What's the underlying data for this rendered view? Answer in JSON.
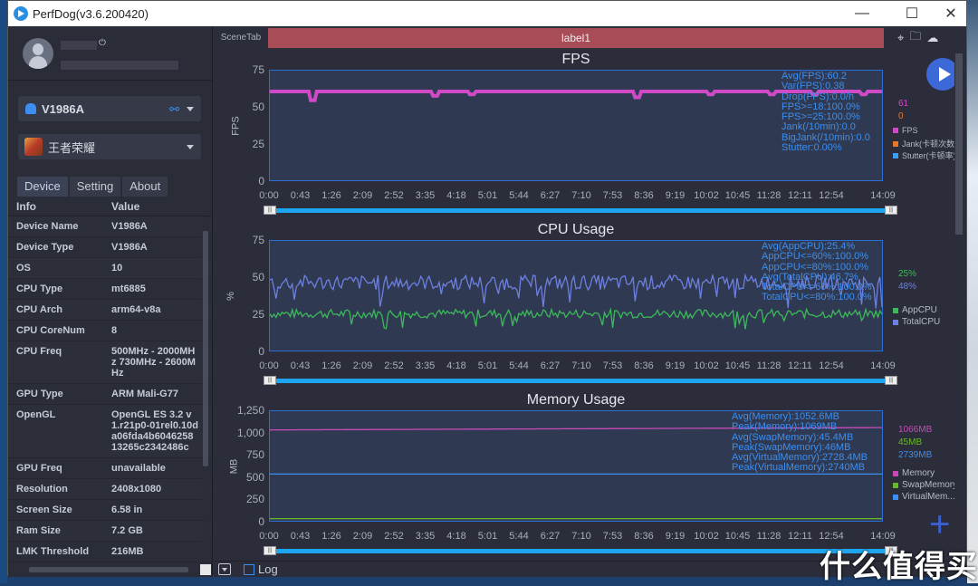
{
  "window": {
    "title": "PerfDog(v3.6.200420)",
    "controls": {
      "minimize": "—",
      "maximize": "☐",
      "close": "✕"
    }
  },
  "sidebar": {
    "device": {
      "name": "V1986A",
      "icon": "android-icon"
    },
    "app": {
      "name": "王者荣耀",
      "icon": "game-icon"
    },
    "tabs": [
      {
        "label": "Device"
      },
      {
        "label": "Setting"
      },
      {
        "label": "About"
      }
    ],
    "table": {
      "headers": [
        "Info",
        "Value"
      ],
      "rows": [
        {
          "key": "Device Name",
          "value": "V1986A"
        },
        {
          "key": "Device Type",
          "value": "V1986A"
        },
        {
          "key": "OS",
          "value": "10"
        },
        {
          "key": "CPU Type",
          "value": "mt6885"
        },
        {
          "key": "CPU Arch",
          "value": "arm64-v8a"
        },
        {
          "key": "CPU CoreNum",
          "value": "8"
        },
        {
          "key": "CPU Freq",
          "value": "500MHz - 2000MHz 730MHz - 2600MHz"
        },
        {
          "key": "GPU Type",
          "value": "ARM Mali-G77"
        },
        {
          "key": "OpenGL",
          "value": "OpenGL ES 3.2 v1.r21p0-01rel0.10da06fda4b604625813265c2342486c"
        },
        {
          "key": "GPU Freq",
          "value": "unavailable"
        },
        {
          "key": "Resolution",
          "value": "2408x1080"
        },
        {
          "key": "Screen Size",
          "value": "6.58 in"
        },
        {
          "key": "Ram Size",
          "value": "7.2 GB"
        },
        {
          "key": "LMK Threshold",
          "value": "216MB"
        }
      ]
    }
  },
  "main": {
    "scene_tab": "SceneTab",
    "label": "label1",
    "top_icons": [
      "location-icon",
      "folder-icon",
      "cloud-icon"
    ],
    "log_label": "Log"
  },
  "watermark": "什么值得买",
  "chart_data": [
    {
      "type": "line",
      "title": "FPS",
      "ylabel": "FPS",
      "ylim": [
        0,
        75
      ],
      "yticks": [
        "0",
        "25",
        "50",
        "75"
      ],
      "xticks": [
        "0:00",
        "0:43",
        "1:26",
        "2:09",
        "2:52",
        "3:35",
        "4:18",
        "5:01",
        "5:44",
        "6:27",
        "7:10",
        "7:53",
        "8:36",
        "9:19",
        "10:02",
        "10:45",
        "11:28",
        "12:11",
        "12:54",
        "14:09"
      ],
      "series": [
        {
          "name": "FPS",
          "color": "#d04ac8",
          "baseline": 61,
          "dips": [
            [
              0.07,
              55
            ],
            [
              0.27,
              58
            ],
            [
              0.33,
              59
            ],
            [
              0.6,
              57
            ],
            [
              0.72,
              59
            ],
            [
              0.82,
              59
            ],
            [
              0.89,
              59
            ],
            [
              0.97,
              59
            ]
          ]
        }
      ],
      "stats": [
        "Avg(FPS):60.2",
        "Var(FPS):0.38",
        "Drop(FPS):0.0/h",
        "FPS>=18:100.0%",
        "FPS>=25:100.0%",
        "Jank(/10min):0.0",
        "BigJank(/10min):0.0",
        "Stutter:0.00%"
      ],
      "current_values": [
        {
          "value": "61",
          "color": "#d04ac8"
        },
        {
          "value": "0",
          "color": "#e8782c"
        }
      ],
      "legend": [
        {
          "label": "FPS",
          "color": "#d04ac8"
        },
        {
          "label": "Jank(卡顿次数)",
          "color": "#e8782c"
        },
        {
          "label": "Stutter(卡顿率)",
          "color": "#3c9ef0"
        }
      ]
    },
    {
      "type": "line",
      "title": "CPU Usage",
      "ylabel": "%",
      "ylim": [
        0,
        75
      ],
      "yticks": [
        "0",
        "25",
        "50",
        "75"
      ],
      "xticks": [
        "0:00",
        "0:43",
        "1:26",
        "2:09",
        "2:52",
        "3:35",
        "4:18",
        "5:01",
        "5:44",
        "6:27",
        "7:10",
        "7:53",
        "8:36",
        "9:19",
        "10:02",
        "10:45",
        "11:28",
        "12:11",
        "12:54",
        "14:09"
      ],
      "series": [
        {
          "name": "AppCPU",
          "color": "#3db85a",
          "mean": 26,
          "noise": 3
        },
        {
          "name": "TotalCPU",
          "color": "#6d7fe0",
          "mean": 47,
          "noise": 5
        }
      ],
      "stats": [
        "Avg(AppCPU):25.4%",
        "AppCPU<=60%:100.0%",
        "AppCPU<=80%:100.0%",
        "Avg(TotalCPU):46.7%",
        "TotalCPU<=60%:100.0%",
        "TotalCPU<=80%:100.0%"
      ],
      "current_values": [
        {
          "value": "25%",
          "color": "#3db85a"
        },
        {
          "value": "48%",
          "color": "#6d7fe0"
        }
      ],
      "legend": [
        {
          "label": "AppCPU",
          "color": "#3db85a"
        },
        {
          "label": "TotalCPU",
          "color": "#6d7fe0"
        }
      ]
    },
    {
      "type": "line",
      "title": "Memory Usage",
      "ylabel": "MB",
      "ylim": [
        0,
        1250
      ],
      "yticks": [
        "0",
        "250",
        "500",
        "750",
        "1,000",
        "1,250"
      ],
      "xticks": [
        "0:00",
        "0:43",
        "1:26",
        "2:09",
        "2:52",
        "3:35",
        "4:18",
        "5:01",
        "5:44",
        "6:27",
        "7:10",
        "7:53",
        "8:36",
        "9:19",
        "10:02",
        "10:45",
        "11:28",
        "12:11",
        "12:54",
        "14:09"
      ],
      "series": [
        {
          "name": "Memory",
          "color": "#c84ab8",
          "start": 1040,
          "end": 1066
        },
        {
          "name": "SwapMemory",
          "color": "#6ab82a",
          "start": 45,
          "end": 45
        },
        {
          "name": "VirtualMemory",
          "color": "#3c8ef0",
          "start": 545,
          "end": 545
        }
      ],
      "stats": [
        "Avg(Memory):1052.6MB",
        "Peak(Memory):1069MB",
        "Avg(SwapMemory):45.4MB",
        "Peak(SwapMemory):46MB",
        "Avg(VirtualMemory):2728.4MB",
        "Peak(VirtualMemory):2740MB"
      ],
      "current_values": [
        {
          "value": "1066MB",
          "color": "#c84ab8"
        },
        {
          "value": "45MB",
          "color": "#6ab82a"
        },
        {
          "value": "2739MB",
          "color": "#3c8ef0"
        }
      ],
      "legend": [
        {
          "label": "Memory",
          "color": "#c84ab8"
        },
        {
          "label": "SwapMemory",
          "color": "#6ab82a"
        },
        {
          "label": "VirtualMem...",
          "color": "#3c8ef0"
        }
      ]
    }
  ]
}
